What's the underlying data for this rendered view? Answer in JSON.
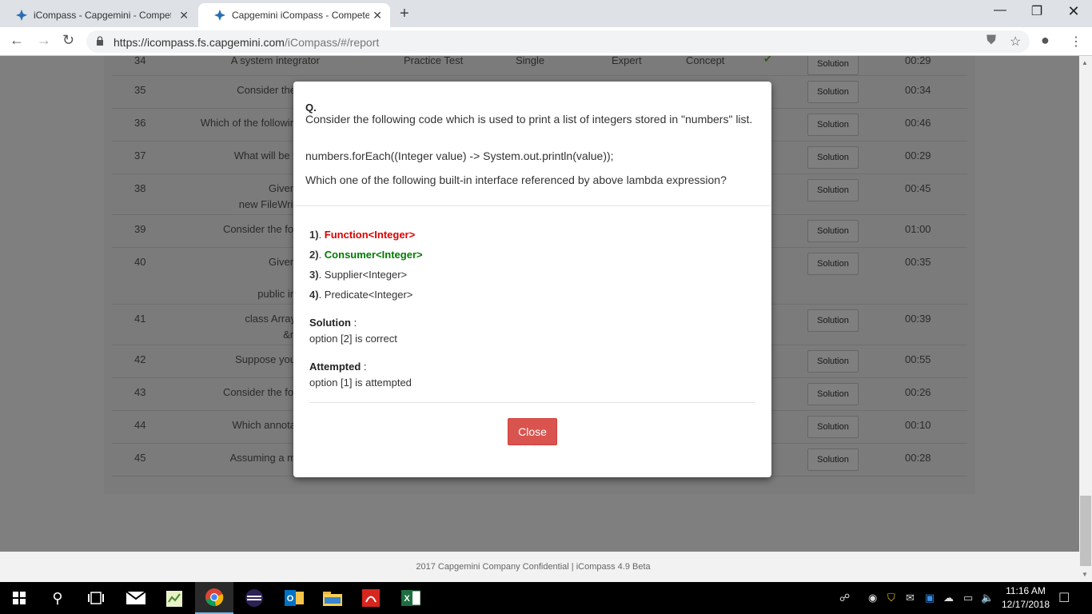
{
  "browser": {
    "tabs": [
      {
        "title": "iCompass - Capgemini - Compet",
        "active": false
      },
      {
        "title": "Capgemini iCompass - Competer",
        "active": true
      }
    ],
    "url_host": "https://icompass.fs.capgemini.com",
    "url_path": "/iCompass/#/report"
  },
  "table": {
    "rows": [
      {
        "num": "35",
        "question": "Consider the",
        "time": "00:34"
      },
      {
        "num": "36",
        "question": "Which of the followin",
        "time": "00:46"
      },
      {
        "num": "37",
        "question": "What will be t",
        "time": "00:29"
      },
      {
        "num": "38",
        "question": "Given",
        "question2": "new FileWrit",
        "time": "00:45"
      },
      {
        "num": "39",
        "question": "Consider the fol",
        "time": "01:00"
      },
      {
        "num": "40",
        "question": "Given",
        "question2": "public in",
        "time": "00:35"
      },
      {
        "num": "41",
        "question": "class Array",
        "question2": "&n",
        "time": "00:39"
      },
      {
        "num": "42",
        "question": "Suppose you",
        "time": "00:55"
      },
      {
        "num": "43",
        "question": "Consider the fol",
        "time": "00:26"
      },
      {
        "num": "44",
        "question": "Which annota",
        "time": "00:10"
      },
      {
        "num": "45",
        "question": "Assuming a m",
        "time": "00:28"
      }
    ],
    "solution_label": "Solution",
    "partial_top": {
      "num": "34",
      "question": "A system integrator",
      "type": "Practice Test",
      "mode": "Single",
      "level": "Expert",
      "category": "Concept",
      "time": "00:29"
    }
  },
  "footer": "2017 Capgemini Company Confidential | iCompass 4.9 Beta",
  "modal": {
    "q_label": "Q.",
    "question": "Consider the following code which is used to print a list of integers stored in \"numbers\" list.",
    "code": "numbers.forEach((Integer value) -> System.out.println(value));",
    "ask": "Which one of the following built-in interface referenced by above lambda expression?",
    "options": [
      {
        "num": "1)",
        "text": "Function<Integer>",
        "status": "attempted-wrong"
      },
      {
        "num": "2)",
        "text": "Consumer<Integer>",
        "status": "correct"
      },
      {
        "num": "3)",
        "text": "Supplier<Integer>",
        "status": "none"
      },
      {
        "num": "4)",
        "text": "Predicate<Integer>",
        "status": "none"
      }
    ],
    "solution_label": "Solution",
    "solution_value": "option [2] is correct",
    "attempted_label": "Attempted",
    "attempted_value": "option [1] is attempted",
    "close_label": "Close"
  },
  "colors": {
    "wrong": "#dd0000",
    "correct": "#007a00",
    "close_button": "#d9534f"
  },
  "taskbar": {
    "time": "11:16 AM",
    "date": "12/17/2018",
    "apps": [
      "windows-start",
      "search",
      "task-view",
      "mail",
      "notepad-plus",
      "chrome",
      "eclipse",
      "outlook",
      "file-explorer",
      "acrobat",
      "excel"
    ]
  }
}
